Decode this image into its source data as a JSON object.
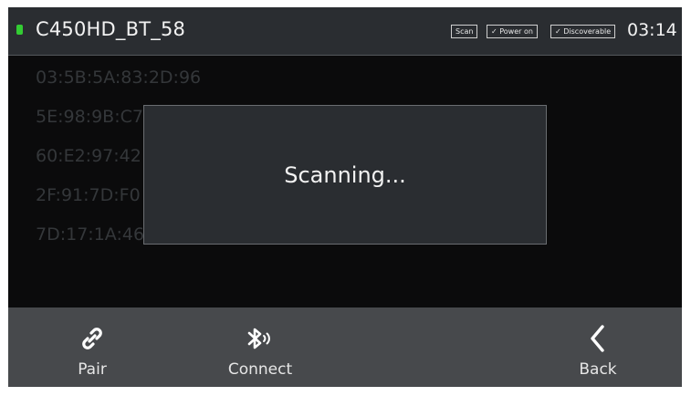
{
  "header": {
    "device_name": "C450HD_BT_58",
    "status": {
      "scan": "Scan",
      "power_on": "✓ Power on",
      "discoverable": "✓ Discoverable"
    },
    "clock": "03:14"
  },
  "device_list": [
    "03:5B:5A:83:2D:96",
    "5E:98:9B:C7",
    "60:E2:97:42",
    "2F:91:7D:F0",
    "7D:17:1A:46"
  ],
  "modal": {
    "message": "Scanning..."
  },
  "bottom_bar": {
    "pair_label": "Pair",
    "connect_label": "Connect",
    "back_label": "Back"
  },
  "icons": {
    "bluetooth_status": "bluetooth-status-icon",
    "pair": "link-icon",
    "connect": "bluetooth-icon",
    "back": "chevron-left-icon"
  },
  "colors": {
    "bluetooth_status": "#33cc33",
    "topbar": "#2a2d31",
    "bottombar": "#47494c"
  }
}
